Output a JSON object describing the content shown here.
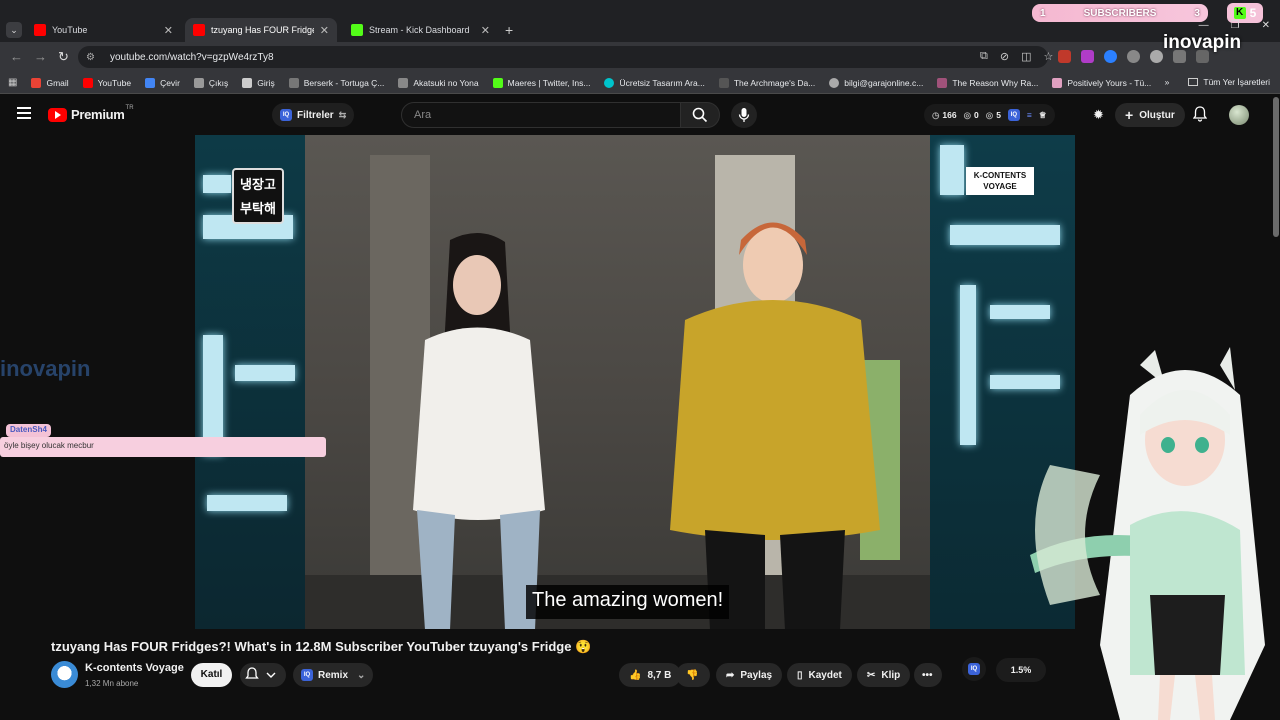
{
  "browser": {
    "tabs": [
      {
        "title": "YouTube",
        "color": "#ff0000"
      },
      {
        "title": "tzuyang Has FOUR Fridges?! W",
        "color": "#ff0000"
      },
      {
        "title": "Stream - Kick Dashboard",
        "color": "#53fc18"
      }
    ],
    "url": "youtube.com/watch?v=gzpWe4rzTy8"
  },
  "overlays": {
    "subscribers_label": "SUBSCRIBERS",
    "subscribers_start": "1",
    "subscribers_end": "3",
    "kick_count": "5",
    "kick_letter": "K",
    "watermark_top": "inovapin",
    "watermark_left": "inovapin",
    "chat_user": "DatenSh4",
    "chat_message": "öyle bişey olucak mecbur"
  },
  "bookmarks": [
    {
      "label": "Gmail",
      "color": "#ea4335"
    },
    {
      "label": "YouTube",
      "color": "#ff0000"
    },
    {
      "label": "Çevir",
      "color": "#4285f4"
    },
    {
      "label": "Çıkış",
      "color": "#999999"
    },
    {
      "label": "Giriş",
      "color": "#cccccc"
    },
    {
      "label": "Berserk - Tortuga Ç...",
      "color": "#777777"
    },
    {
      "label": "Akatsuki no Yona",
      "color": "#888888"
    },
    {
      "label": "Maeres | Twitter, Ins...",
      "color": "#53fc18"
    },
    {
      "label": "Ücretsiz Tasarım Ara...",
      "color": "#00c4cc"
    },
    {
      "label": "The Archmage's Da...",
      "color": "#555555"
    },
    {
      "label": "bilgi@garajonline.c...",
      "color": "#aaaaaa"
    },
    {
      "label": "The Reason Why Ra...",
      "color": "#a0527a"
    },
    {
      "label": "Positively Yours - Tü...",
      "color": "#e0a0c0"
    }
  ],
  "bookmarks_all": "Tüm Yer İşaretleri",
  "header": {
    "logo": "Premium",
    "country": "TR",
    "filters_label": "Filtreler",
    "iq_label": "IQ",
    "search_placeholder": "Ara",
    "stat_views": "166",
    "stat_a": "0",
    "stat_b": "5",
    "create_label": "Oluştur"
  },
  "video": {
    "subtitle": "The amazing women!",
    "show_logo_left": "냉장고 부탁해",
    "show_logo_right": "K-CONTENTS VOYAGE",
    "title": "tzuyang Has FOUR Fridges?! What's in 12.8M Subscriber YouTuber tzuyang's Fridge 😲"
  },
  "channel": {
    "name": "K-contents Voyage",
    "subscribers": "1,32 Mn abone",
    "join_label": "Katıl",
    "remix_label": "Remix"
  },
  "actions": {
    "likes": "8,7 B",
    "share": "Paylaş",
    "save": "Kaydet",
    "clip": "Klip",
    "percent": "1.5%"
  }
}
